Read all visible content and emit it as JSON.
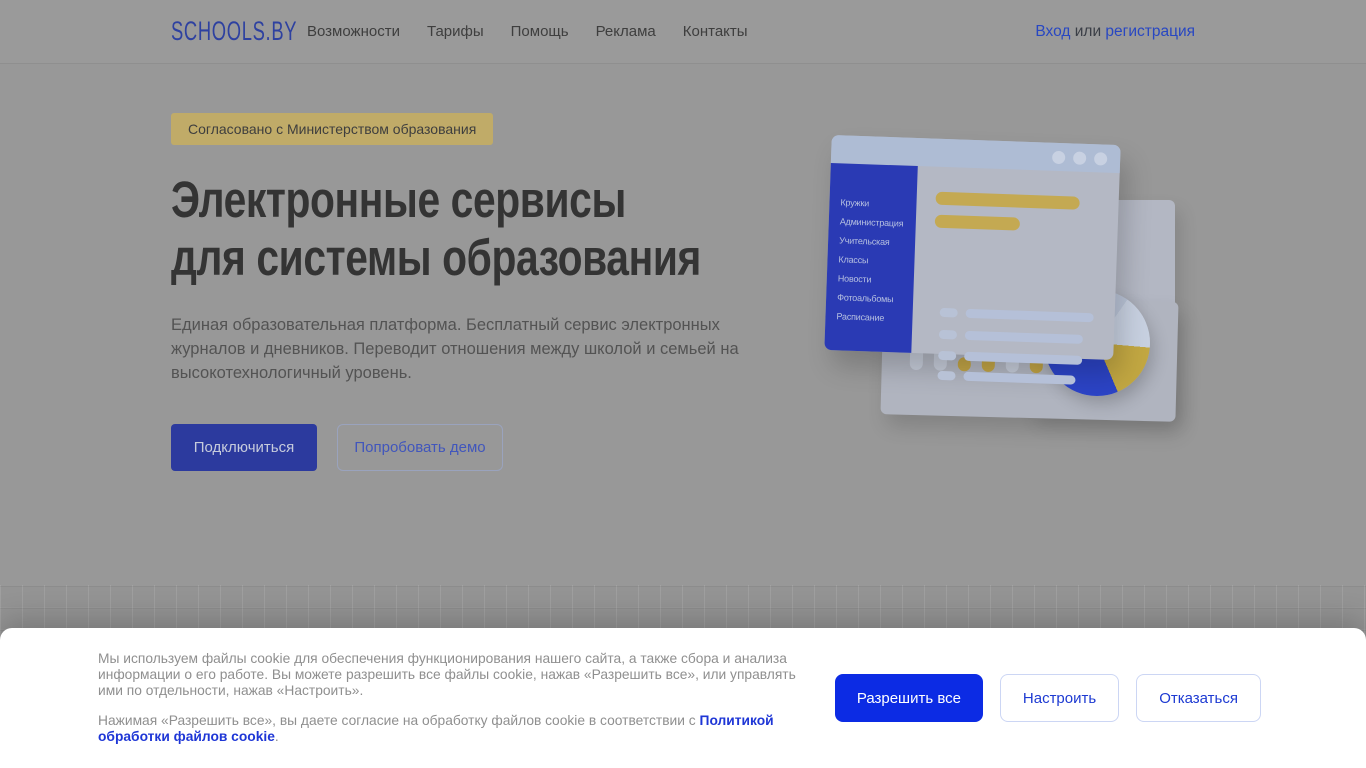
{
  "nav": {
    "logo": "SCHOOLS.BY",
    "items": [
      "Возможности",
      "Тарифы",
      "Помощь",
      "Реклама",
      "Контакты"
    ],
    "auth": {
      "login": "Вход",
      "separator": " или ",
      "register": "регистрация"
    }
  },
  "hero": {
    "badge": "Согласовано с Министерством образования",
    "title_line1": "Электронные сервисы",
    "title_line2": "для системы образования",
    "description": "Единая образовательная платформа. Бесплатный сервис электронных журналов и дневников. Переводит отношения между школой и семьей на высокотехнологичный уровень.",
    "primary_button": "Подключиться",
    "secondary_button": "Попробовать демо"
  },
  "illustration": {
    "menu": [
      "Кружки",
      "Администрация",
      "Учительская",
      "Классы",
      "Новости",
      "Фотоальбомы",
      "Расписание"
    ]
  },
  "cookie": {
    "para1": "Мы используем файлы cookie для обеспечения функционирования нашего сайта, а также сбора и анализа информации о его работе. Вы можете разрешить все файлы cookie, нажав «Разрешить все», или управлять ими по отдельности, нажав «Настроить».",
    "para2_before": "Нажимая «Разрешить все», вы даете согласие на обработку файлов cookie в соответствии с ",
    "policy_link": "Политикой обработки файлов cookie",
    "para2_after": ".",
    "allow_button": "Разрешить все",
    "configure_button": "Настроить",
    "decline_button": "Отказаться"
  },
  "colors": {
    "accent_blue": "#0c2be4",
    "logo_blue": "#2e41a0",
    "sidebar_blue": "#2a3ab4",
    "badge_bg": "#c0ab68",
    "bar_yellow": "#c4a952"
  }
}
